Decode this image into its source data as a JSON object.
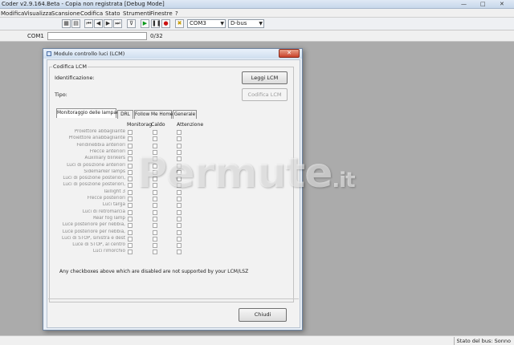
{
  "app": {
    "title": "Coder v2.9.164.Beta - Copia non registrata [Debug Mode]",
    "window_controls": [
      "—",
      "□",
      "✕"
    ]
  },
  "menu": [
    "Modifica",
    "Visualizza",
    "Scansione",
    "Codifica",
    "Stato",
    "Strumenti",
    "Finestre",
    "?"
  ],
  "toolbar": {
    "buttons": [
      {
        "name": "grid-icon",
        "glyph": "▦"
      },
      {
        "name": "list-icon",
        "glyph": "▤"
      },
      {
        "name": "first-icon",
        "glyph": "⏮"
      },
      {
        "name": "prev-icon",
        "glyph": "◀"
      },
      {
        "name": "next-icon",
        "glyph": "▶"
      },
      {
        "name": "last-icon",
        "glyph": "⏭"
      },
      {
        "name": "filter-icon",
        "glyph": "⊽"
      },
      {
        "name": "play-icon",
        "glyph": "▶"
      },
      {
        "name": "pause-icon",
        "glyph": "❚❚"
      },
      {
        "name": "stop-icon",
        "glyph": "●"
      },
      {
        "name": "tools-icon",
        "glyph": "✖"
      }
    ],
    "port_value": "COM3",
    "bus_value": "D-bus"
  },
  "status_row": {
    "port": "COM1",
    "count": "0/32"
  },
  "dialog": {
    "title": "Modulo controllo luci (LCM)",
    "close": "✕",
    "group_label": "Codifica LCM",
    "identification_label": "Identificazione:",
    "type_label": "Tipo:",
    "read_button": "Leggi LCM",
    "code_button": "Codifica LCM",
    "tabs": [
      "Monitoraggio delle lampade",
      "DRL",
      "Follow Me Home",
      "Generale"
    ],
    "columns": [
      "Monitorag",
      "Caldo",
      "Attenzione"
    ],
    "rows": [
      "Proiettore abbagliante",
      "Proiettore anabbagliante",
      "Fendinebbia anteriori",
      "Frecce anteriori",
      "Auxilliary blinkers",
      "Luci di posizione anteriori",
      "Sidemarker lamps",
      "Luci di posizione posteriori,",
      "Luci di posizione posteriori,",
      "Taillight 3",
      "Frecce posteriori",
      "Luci targa",
      "Luci di retromarcia",
      "Rear fog lamp",
      "Luce posteriore per nebbia,",
      "Luce posteriore per nebbia,",
      "Luci di STOP, sinistra e dest",
      "Luce di STOP, al centro",
      "Luci rimorchio"
    ],
    "note": "Any checkboxes above which are disabled are not supported by your LCM/LSZ",
    "close_button": "Chiudi"
  },
  "watermark": {
    "main": "Permute",
    "suffix": ".it"
  },
  "statusbar": {
    "text": "Stato del bus: Sonno"
  }
}
